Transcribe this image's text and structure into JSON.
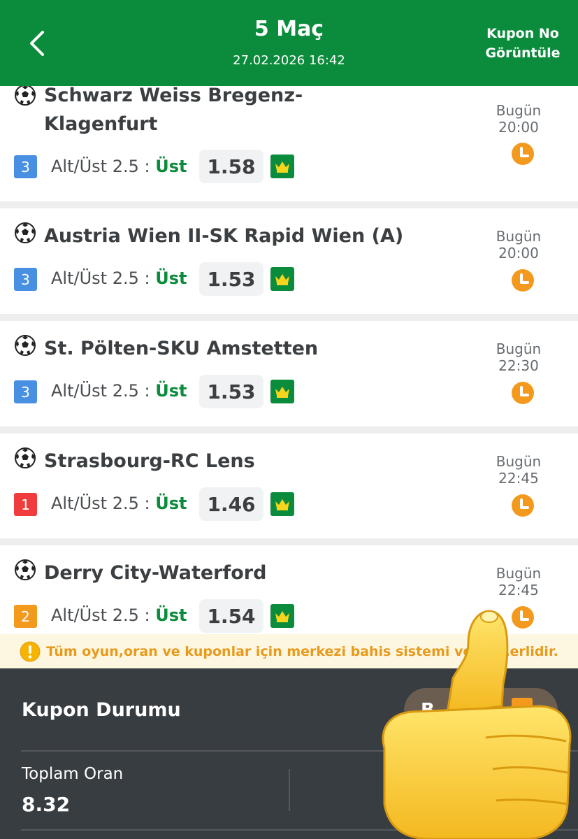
{
  "header": {
    "title": "5 Maç",
    "datetime": "27.02.2026 16:42",
    "kupon_line1": "Kupon No",
    "kupon_line2": "Görüntüle"
  },
  "matches": [
    {
      "teams": "Schwarz Weiss Bregenz-Klagenfurt",
      "rank": "3",
      "rank_color": "#4a90e2",
      "market": "Alt/Üst 2.5 :",
      "pick": "Üst",
      "odd": "1.58",
      "day": "Bugün",
      "time": "20:00"
    },
    {
      "teams": "Austria Wien II-SK Rapid Wien (A)",
      "rank": "3",
      "rank_color": "#4a90e2",
      "market": "Alt/Üst 2.5 :",
      "pick": "Üst",
      "odd": "1.53",
      "day": "Bugün",
      "time": "20:00"
    },
    {
      "teams": "St. Pölten-SKU Amstetten",
      "rank": "3",
      "rank_color": "#4a90e2",
      "market": "Alt/Üst 2.5 :",
      "pick": "Üst",
      "odd": "1.53",
      "day": "Bugün",
      "time": "22:30"
    },
    {
      "teams": "Strasbourg-RC Lens",
      "rank": "1",
      "rank_color": "#f03c3c",
      "market": "Alt/Üst 2.5 :",
      "pick": "Üst",
      "odd": "1.46",
      "day": "Bugün",
      "time": "22:45"
    },
    {
      "teams": "Derry City-Waterford",
      "rank": "2",
      "rank_color": "#f39a1e",
      "market": "Alt/Üst 2.5 :",
      "pick": "Üst",
      "odd": "1.54",
      "day": "Bugün",
      "time": "22:45"
    }
  ],
  "notice": "Tüm oyun,oran ve kuponlar için merkezi bahis sistemi verile…erlidir.",
  "panel": {
    "title": "Kupon Durumu",
    "button_label": "B",
    "total_label": "Toplam Oran",
    "total_value": "8.32"
  },
  "colors": {
    "header_green": "#0b8c3c",
    "pick_green": "#0b8c3c",
    "clock_orange": "#f39a1e",
    "panel_dark": "#383d42",
    "notice_text": "#e79a1b"
  },
  "icons": [
    "back-arrow-icon",
    "soccer-ball-icon",
    "clock-icon",
    "crown-icon",
    "warning-icon",
    "thumbs-up-emoji"
  ]
}
